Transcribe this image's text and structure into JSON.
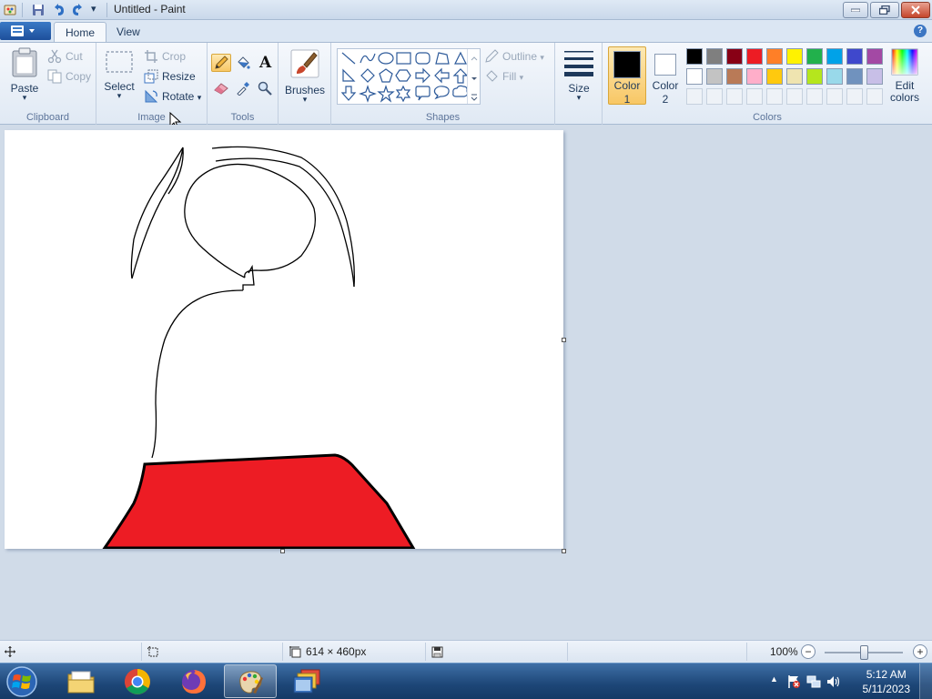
{
  "window": {
    "title": "Untitled - Paint",
    "qa_dropdown": "▾"
  },
  "tabs": [
    {
      "label": "Home",
      "active": true
    },
    {
      "label": "View",
      "active": false
    }
  ],
  "help_icon": "?",
  "clipboard": {
    "group_label": "Clipboard",
    "paste_label": "Paste",
    "paste_arrow": "▾",
    "cut_label": "Cut",
    "copy_label": "Copy"
  },
  "image": {
    "group_label": "Image",
    "select_label": "Select",
    "select_arrow": "▾",
    "crop_label": "Crop",
    "resize_label": "Resize",
    "rotate_label": "Rotate",
    "rotate_arrow": "▾"
  },
  "tools": {
    "group_label": "Tools",
    "items": [
      "pencil-icon",
      "fill-icon",
      "text-icon",
      "eraser-icon",
      "color-picker-icon",
      "magnifier-icon"
    ],
    "text_glyph": "A"
  },
  "brushes": {
    "label": "Brushes",
    "arrow": "▾"
  },
  "shapes": {
    "group_label": "Shapes",
    "outline_label": "Outline",
    "fill_label": "Fill",
    "items": [
      "line",
      "curve",
      "oval",
      "rectangle",
      "rounded-rectangle",
      "polygon",
      "triangle",
      "right-triangle",
      "diamond",
      "pentagon",
      "hexagon",
      "right-arrow",
      "left-arrow",
      "up-arrow",
      "down-arrow",
      "four-point-star",
      "five-point-star",
      "six-point-star",
      "rounded-callout",
      "oval-callout",
      "cloud-callout"
    ]
  },
  "size": {
    "label": "Size",
    "arrow": "▾"
  },
  "colors": {
    "group_label": "Colors",
    "color1_label": "Color",
    "color1_num": "1",
    "color1_value": "#000000",
    "color2_label": "Color",
    "color2_num": "2",
    "color2_value": "#ffffff",
    "edit_label": "Edit",
    "edit_label2": "colors",
    "palette_row1": [
      "#000000",
      "#7f7f7f",
      "#880015",
      "#ed1c24",
      "#ff7f27",
      "#fff200",
      "#22b14c",
      "#00a2e8",
      "#3f48cc",
      "#a349a4"
    ],
    "palette_row2": [
      "#ffffff",
      "#c3c3c3",
      "#b97a57",
      "#ffaec9",
      "#ffc90e",
      "#efe4b0",
      "#b5e61d",
      "#99d9ea",
      "#7092be",
      "#c8bfe7"
    ],
    "palette_row3_empty": 10
  },
  "canvas": {
    "fill_color": "#ed1c24",
    "stroke_color": "#000000"
  },
  "status": {
    "dimensions": "614 × 460px",
    "zoom": "100%",
    "zoom_minus": "−",
    "zoom_plus": "+"
  },
  "taskbar": {
    "time": "5:12 AM",
    "date": "5/11/2023",
    "tray_arrow": "▲"
  }
}
